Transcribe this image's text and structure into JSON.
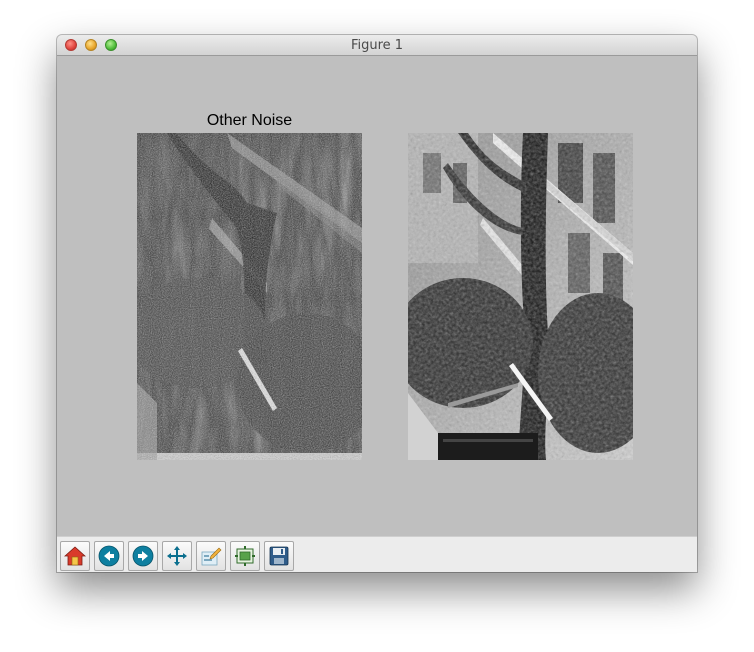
{
  "window": {
    "title": "Figure 1"
  },
  "figure": {
    "left_axes_title": "Other Noise",
    "right_axes_title": ""
  },
  "toolbar": {
    "tools": [
      {
        "name": "home-icon"
      },
      {
        "name": "back-icon"
      },
      {
        "name": "forward-icon"
      },
      {
        "name": "pan-icon"
      },
      {
        "name": "configure-subplots-icon"
      },
      {
        "name": "zoom-to-rect-icon"
      },
      {
        "name": "save-icon"
      }
    ]
  },
  "colors": {
    "figure_background": "#bfbfbf",
    "toolbar_background": "#ececec",
    "tool_icon_accent": "#0e7fa0"
  }
}
